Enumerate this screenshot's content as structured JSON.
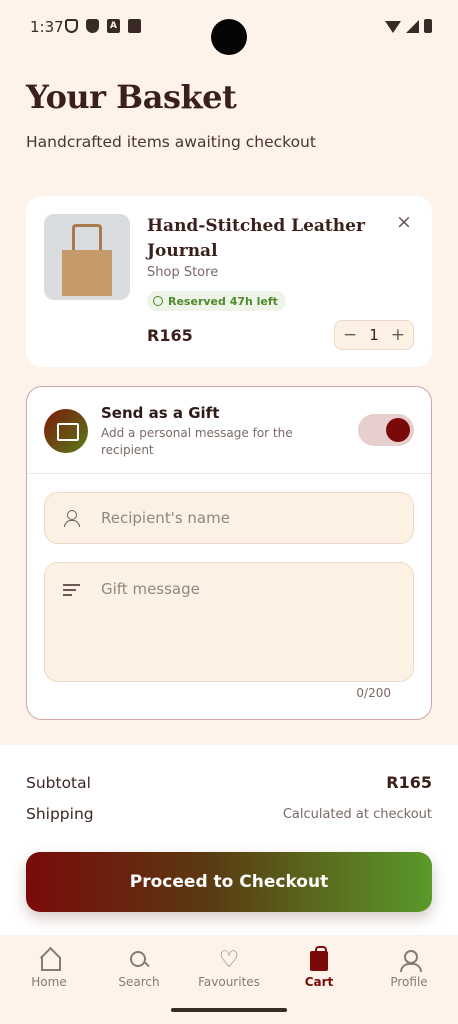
{
  "status_bar": {
    "time": "1:37"
  },
  "header": {
    "title": "Your Basket",
    "subtitle": "Handcrafted items awaiting checkout"
  },
  "cart_item": {
    "name": "Hand-Stitched Leather Journal",
    "store": "Shop Store",
    "reserved_label": "Reserved 47h left",
    "price": "R165",
    "quantity": "1",
    "decrement": "−",
    "increment": "+",
    "remove": "×"
  },
  "gift": {
    "title": "Send as a Gift",
    "description": "Add a personal message for the recipient",
    "toggle_on": true,
    "recipient_placeholder": "Recipient's name",
    "message_placeholder": "Gift message",
    "char_count": "0/200"
  },
  "summary": {
    "subtotal_label": "Subtotal",
    "subtotal_value": "R165",
    "shipping_label": "Shipping",
    "shipping_value": "Calculated at checkout",
    "checkout_label": "Proceed to Checkout"
  },
  "nav": {
    "items": [
      {
        "label": "Home",
        "icon": "home-icon"
      },
      {
        "label": "Search",
        "icon": "search-icon"
      },
      {
        "label": "Favourites",
        "icon": "heart-icon"
      },
      {
        "label": "Cart",
        "icon": "bag-icon"
      },
      {
        "label": "Profile",
        "icon": "profile-icon"
      }
    ],
    "active": "Cart"
  },
  "colors": {
    "background": "#fdf3ea",
    "accent": "#7a0a0a",
    "success": "#4f8a2c"
  }
}
